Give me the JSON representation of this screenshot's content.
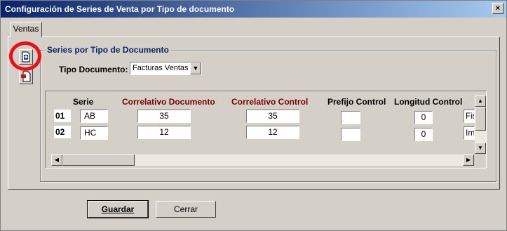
{
  "window": {
    "title": "Configuración de Series de Venta por Tipo de documento",
    "close_glyph": "×"
  },
  "tabs": [
    {
      "label": "Ventas"
    }
  ],
  "group": {
    "label": "Series por Tipo de Documento"
  },
  "tipo": {
    "label": "Tipo Documento:",
    "value": "Facturas Ventas"
  },
  "headers": {
    "serie": "Serie",
    "correlativo_documento": "Correlativo Documento",
    "correlativo_control": "Correlativo Control",
    "prefijo_control": "Prefijo Control",
    "longitud_control": "Longitud Control"
  },
  "rows": [
    {
      "num": "01",
      "serie": "AB",
      "correlativo_documento": "35",
      "correlativo_control": "35",
      "prefijo_control": "",
      "longitud_control": "0",
      "extra": "Fis"
    },
    {
      "num": "02",
      "serie": "HC",
      "correlativo_documento": "12",
      "correlativo_control": "12",
      "prefijo_control": "",
      "longitud_control": "0",
      "extra": "Im"
    }
  ],
  "buttons": {
    "guardar": "Guardar",
    "cerrar": "Cerrar"
  },
  "icons": {
    "add": "add-row-icon",
    "remove": "remove-row-icon"
  },
  "colors": {
    "highlight_ring": "#e8101b",
    "header_red": "#7b0000",
    "group_title": "#0a246a"
  }
}
